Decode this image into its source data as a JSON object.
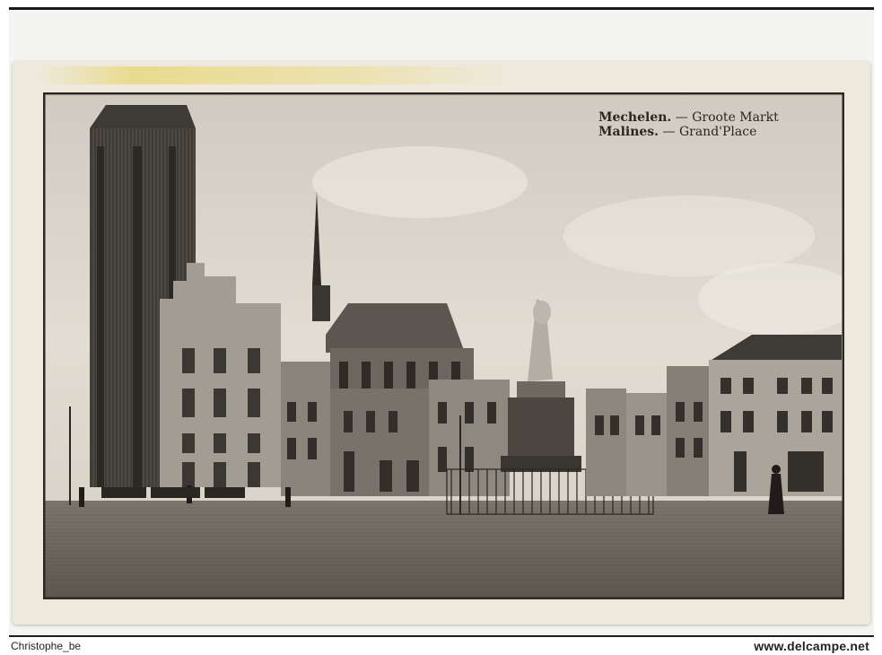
{
  "caption": {
    "line1_place": "Mechelen.",
    "line1_sep": " — ",
    "line1_name": "Groote Markt",
    "line2_place": "Malines.",
    "line2_sep": " — ",
    "line2_name": "Grand'Place"
  },
  "footer": {
    "uploader": "Christophe_be",
    "site": "www.delcampe.net"
  },
  "colors": {
    "card": "#eee9dc",
    "sepia_dark": "#3a3530",
    "sky": "#dcd7cc"
  }
}
